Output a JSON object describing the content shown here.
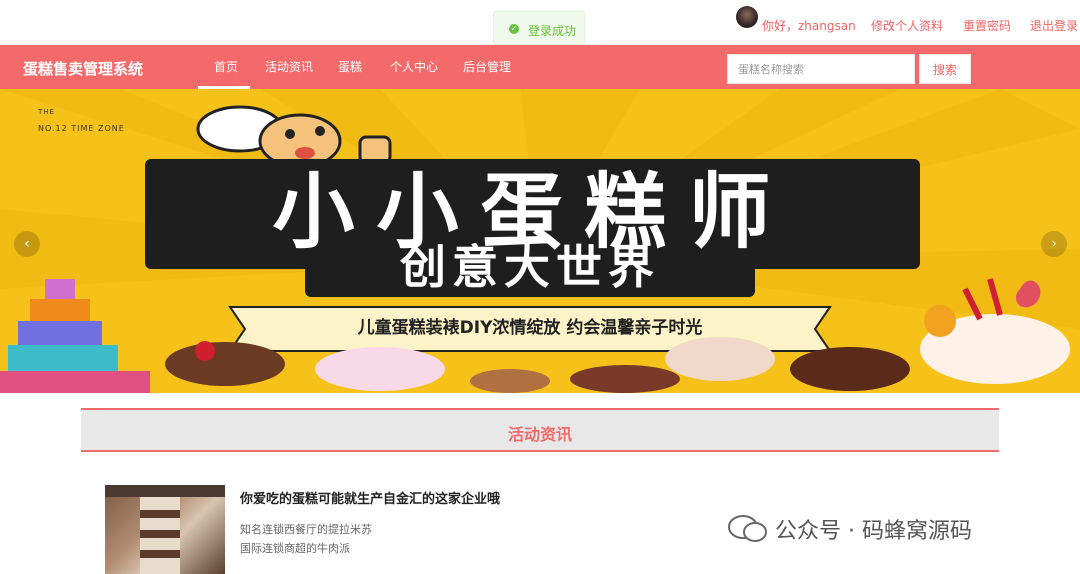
{
  "userbar": {
    "greeting": "你好，zhangsan",
    "edit_profile": "修改个人资料",
    "reset_password": "重置密码",
    "logout": "退出登录"
  },
  "toast": {
    "message": "登录成功"
  },
  "nav": {
    "logo": "蛋糕售卖管理系统",
    "items": [
      "首页",
      "活动资讯",
      "蛋糕",
      "个人中心",
      "后台管理"
    ],
    "active_index": 0,
    "search_placeholder": "蛋糕名称搜索",
    "search_button": "搜索"
  },
  "banner": {
    "tag_line_1": "THE",
    "tag_line_2": "NO.12 TIME ZONE",
    "headline": "小小蛋糕师",
    "subheadline": "创意大世界",
    "ribbon": "儿童蛋糕装裱DIY浓情绽放 约会温馨亲子时光",
    "prev": "‹",
    "next": "›"
  },
  "section": {
    "title": "活动资讯"
  },
  "news": [
    {
      "title": "你爱吃的蛋糕可能就生产自金汇的这家企业哦",
      "lines": [
        "知名连锁西餐厅的提拉米苏",
        "国际连锁商超的牛肉派"
      ]
    }
  ],
  "watermark": {
    "text": "公众号 · 码蜂窝源码"
  },
  "colors": {
    "accent": "#f46a6a",
    "banner_bg": "#f6c21a",
    "toast_green": "#67c23a"
  }
}
